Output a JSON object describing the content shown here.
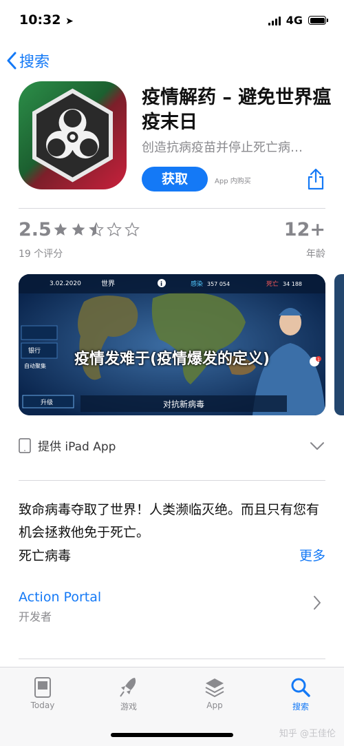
{
  "status_bar": {
    "time": "10:32",
    "network": "4G"
  },
  "nav": {
    "back_label": "搜索"
  },
  "app": {
    "title": "疫情解药 – 避免世界瘟疫末日",
    "subtitle": "创造抗病疫苗并停止死亡病…",
    "get_label": "获取",
    "iap_label": "App 内购买"
  },
  "ratings": {
    "score": "2.5",
    "stars": 2.5,
    "count_label": "19 个评分",
    "age": "12+",
    "age_label": "年龄"
  },
  "screenshot": {
    "date": "3.02.2020",
    "world_label": "世界",
    "infected_label": "感染",
    "infected_value": "357 054",
    "dead_label": "死亡",
    "dead_value": "34 188",
    "bank_label": "银行",
    "auto_label": "自动聚集",
    "upgrade_label": "升级",
    "caption": "对抗新病毒",
    "badge": "1"
  },
  "overlay_text": "疫情发难于(疫情爆发的定义)",
  "device": {
    "label": "提供 iPad App"
  },
  "description": {
    "text": "致命病毒夺取了世界！人类濒临灭绝。而且只有您有机会拯救他免于死亡。",
    "developer": "死亡病毒",
    "more_label": "更多"
  },
  "developer": {
    "name": "Action Portal",
    "label": "开发者"
  },
  "tabs": [
    {
      "label": "Today",
      "icon": "today-icon"
    },
    {
      "label": "游戏",
      "icon": "rocket-icon"
    },
    {
      "label": "App",
      "icon": "layers-icon"
    },
    {
      "label": "搜索",
      "icon": "search-icon"
    }
  ],
  "watermark": "知乎 @王佳伦",
  "colors": {
    "accent": "#1479f6",
    "icon_green": "#2c8f49",
    "icon_red": "#c8213c"
  }
}
